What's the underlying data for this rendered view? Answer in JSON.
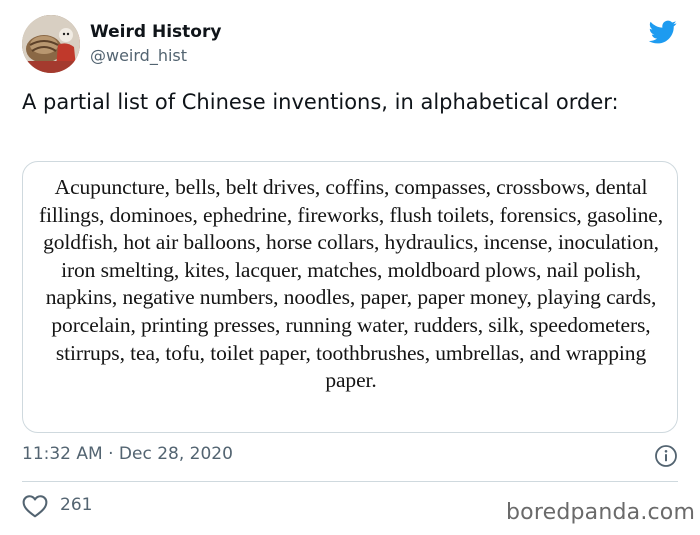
{
  "author": {
    "display_name": "Weird History",
    "handle": "@weird_hist"
  },
  "tweet": {
    "text": "A partial list of Chinese inventions, in alphabetical order:",
    "timestamp": "11:32 AM · Dec 28, 2020",
    "like_count": "261"
  },
  "media": {
    "text": "Acupuncture, bells, belt drives, coffins, compasses, crossbows, dental fillings, dominoes, ephedrine, fireworks, flush toilets, forensics, gasoline, goldfish, hot air balloons, horse collars, hydraulics, incense, inoculation, iron smelting, kites, lacquer, matches, moldboard plows, nail polish, napkins, negative numbers, noodles, paper, paper money, playing cards, porcelain, printing presses, running water, rudders, silk, speedometers, stirrups, tea, tofu, toilet paper, toothbrushes, umbrellas, and wrapping paper."
  },
  "watermark": "boredpanda.com",
  "icons": {
    "brand": "twitter-bird-icon",
    "info": "info-icon",
    "like": "heart-icon"
  },
  "colors": {
    "twitter_blue": "#1d9bf0",
    "secondary_text": "#536471",
    "border": "#cfd9de"
  }
}
